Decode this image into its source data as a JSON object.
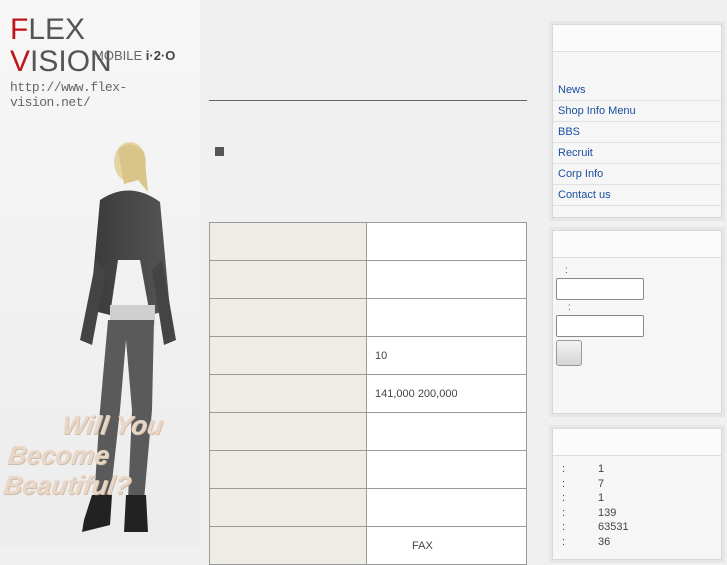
{
  "logo": {
    "first_letter": "F",
    "title_rest_1": "LEX ",
    "second_letter": "V",
    "title_rest_2": "ISION",
    "url": "http://www.flex-vision.net/",
    "mobile_label": "MOBILE",
    "mobile_brand": "i·2·O"
  },
  "slogan": {
    "line1": "Will You",
    "line2": "Become Beautiful?"
  },
  "main": {
    "bullet_text": "",
    "table_rows": [
      {
        "key": "",
        "value": ""
      },
      {
        "key": "",
        "value": ""
      },
      {
        "key": "",
        "value": ""
      },
      {
        "key": "",
        "value": "10"
      },
      {
        "key": "",
        "value": "141,000 200,000"
      },
      {
        "key": "",
        "value": ""
      },
      {
        "key": "",
        "value": ""
      },
      {
        "key": "",
        "value": ""
      },
      {
        "key": "",
        "value": "FAX"
      }
    ]
  },
  "sidebar": {
    "nav": [
      "News",
      "Shop Info   Menu",
      "BBS",
      "Recruit",
      "Corp Info",
      "Contact us"
    ],
    "login_label_1": ":",
    "login_label_2": ":",
    "stats": [
      {
        "colon": ":",
        "value": "1"
      },
      {
        "colon": ":",
        "value": "7"
      },
      {
        "colon": ":",
        "value": "1"
      },
      {
        "colon": ":",
        "value": "139"
      },
      {
        "colon": ":",
        "value": "63531"
      },
      {
        "colon": ":",
        "value": "36"
      }
    ]
  },
  "colors": {
    "logo_red": "#c0141b",
    "link_blue": "#1a4fa0",
    "table_key_bg": "#efebe5"
  }
}
